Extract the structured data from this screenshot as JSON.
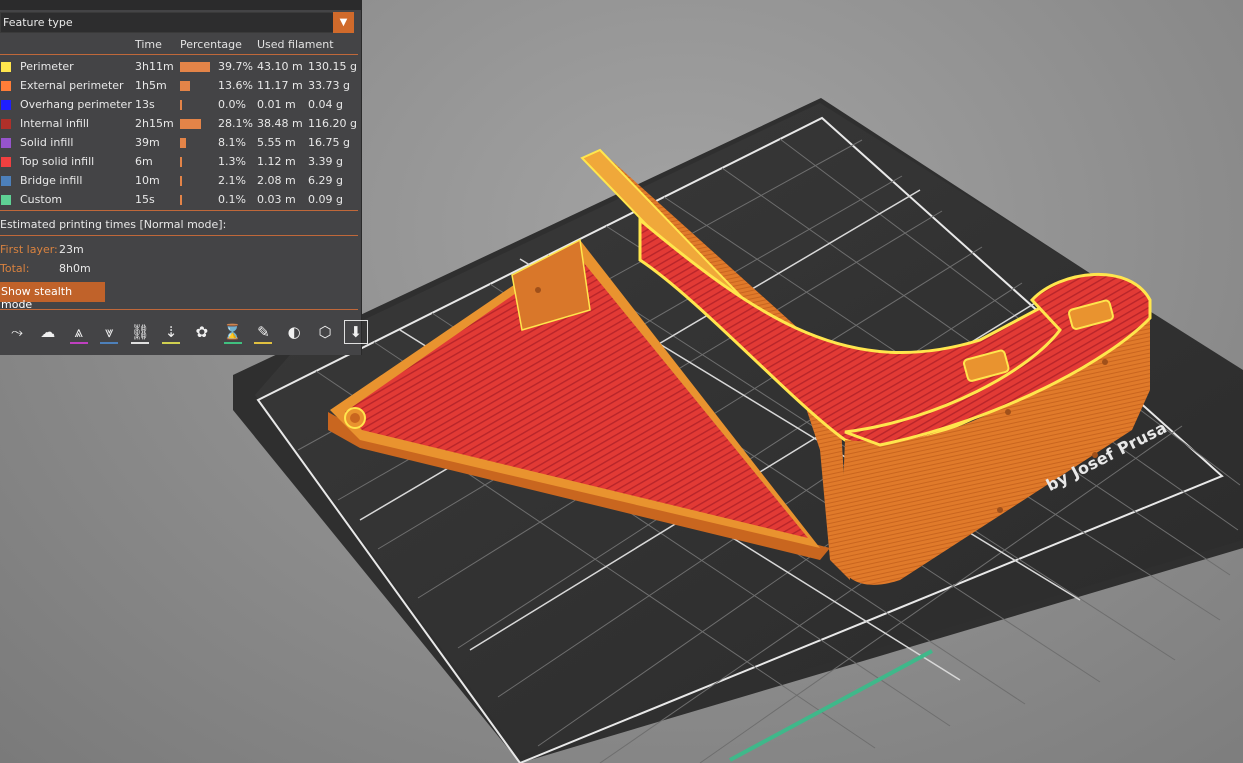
{
  "legend": {
    "view_type": "Feature type",
    "columns": {
      "time": "Time",
      "percentage": "Percentage",
      "used_filament": "Used filament"
    },
    "features": [
      {
        "name": "Perimeter",
        "color": "#ffe64d",
        "time": "3h11m",
        "percent": 39.7,
        "percent_label": "39.7%",
        "length": "43.10 m",
        "weight": "130.15 g"
      },
      {
        "name": "External perimeter",
        "color": "#ff7d38",
        "time": "1h5m",
        "percent": 13.6,
        "percent_label": "13.6%",
        "length": "11.17 m",
        "weight": "33.73 g"
      },
      {
        "name": "Overhang perimeter",
        "color": "#1f1fff",
        "time": "13s",
        "percent": 0.0,
        "percent_label": "0.0%",
        "length": "0.01 m",
        "weight": "0.04 g"
      },
      {
        "name": "Internal infill",
        "color": "#b03029",
        "time": "2h15m",
        "percent": 28.1,
        "percent_label": "28.1%",
        "length": "38.48 m",
        "weight": "116.20 g"
      },
      {
        "name": "Solid infill",
        "color": "#9654cc",
        "time": "39m",
        "percent": 8.1,
        "percent_label": "8.1%",
        "length": "5.55 m",
        "weight": "16.75 g"
      },
      {
        "name": "Top solid infill",
        "color": "#f04040",
        "time": "6m",
        "percent": 1.3,
        "percent_label": "1.3%",
        "length": "1.12 m",
        "weight": "3.39 g"
      },
      {
        "name": "Bridge infill",
        "color": "#4d80ba",
        "time": "10m",
        "percent": 2.1,
        "percent_label": "2.1%",
        "length": "2.08 m",
        "weight": "6.29 g"
      },
      {
        "name": "Custom",
        "color": "#5ed194",
        "time": "15s",
        "percent": 0.1,
        "percent_label": "0.1%",
        "length": "0.03 m",
        "weight": "0.09 g"
      }
    ],
    "estimated_title": "Estimated printing times [Normal mode]:",
    "first_layer_label": "First layer:",
    "first_layer_value": "23m",
    "total_label": "Total:",
    "total_value": "8h0m",
    "stealth_button": "Show stealth mode",
    "toolbar": [
      {
        "icon": "travel-icon",
        "glyph": "⤳",
        "accent": ""
      },
      {
        "icon": "wipe-icon",
        "glyph": "☁",
        "accent": ""
      },
      {
        "icon": "retractions-icon",
        "glyph": "⩓",
        "accent": "#c040c0"
      },
      {
        "icon": "deretractions-icon",
        "glyph": "⩔",
        "accent": "#4d80ba"
      },
      {
        "icon": "seams-icon",
        "glyph": "⛓",
        "accent": "#e0e0e0"
      },
      {
        "icon": "tool-changes-icon",
        "glyph": "⇣",
        "accent": "#d0d050"
      },
      {
        "icon": "color-changes-icon",
        "glyph": "✿",
        "accent": ""
      },
      {
        "icon": "pause-prints-icon",
        "glyph": "⌛",
        "accent": "#40c080"
      },
      {
        "icon": "custom-gcodes-icon",
        "glyph": "✎",
        "accent": "#e0c040"
      },
      {
        "icon": "center-of-gravity-icon",
        "glyph": "◐",
        "accent": ""
      },
      {
        "icon": "shells-icon",
        "glyph": "⬡",
        "accent": ""
      },
      {
        "icon": "tool-marker-icon",
        "glyph": "⬇",
        "accent": ""
      }
    ]
  },
  "viewport": {
    "bed_watermark": "by Josef Prusa"
  }
}
